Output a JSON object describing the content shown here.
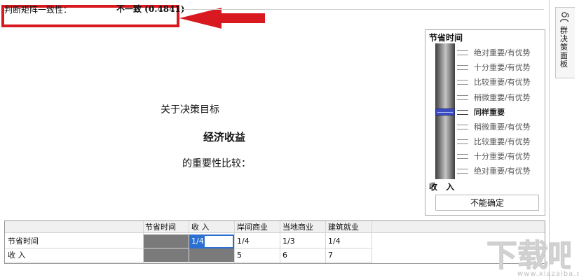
{
  "consistency": {
    "label": "判断矩阵一致性：",
    "value": "不一致 (0.4841)"
  },
  "decision": {
    "goal_prefix": "关于决策目标",
    "goal_name": "经济收益",
    "compare_suffix": "的重要性比较："
  },
  "slider": {
    "top_label": "节省时间",
    "bottom_label": "收 入",
    "scale": [
      "绝对重要/有优势",
      "十分重要/有优势",
      "比较重要/有优势",
      "稍微重要/有优势",
      "同样重要",
      "稍微重要/有优势",
      "比较重要/有优势",
      "十分重要/有优势",
      "绝对重要/有优势"
    ],
    "selected_level": "同样重要",
    "undetermined_button": "不能确定"
  },
  "side_tab": {
    "label": "群决策面板",
    "icon": "group-user-icon"
  },
  "matrix": {
    "columns": [
      "节省时间",
      "收 入",
      "岸间商业",
      "当地商业",
      "建筑就业"
    ],
    "rows": [
      {
        "name": "节省时间",
        "cells": [
          "",
          "1/4",
          "1/4",
          "1/3",
          "1/4"
        ]
      },
      {
        "name": "收 入",
        "cells": [
          "",
          "",
          "5",
          "6",
          "7"
        ]
      }
    ]
  },
  "watermark": {
    "text": "下载吧",
    "site": "www.xiazaiba.com"
  },
  "colors": {
    "alert_red": "#d8191f",
    "selection_blue": "#2b6fd1",
    "disabled_cell": "#7a7a7a"
  }
}
